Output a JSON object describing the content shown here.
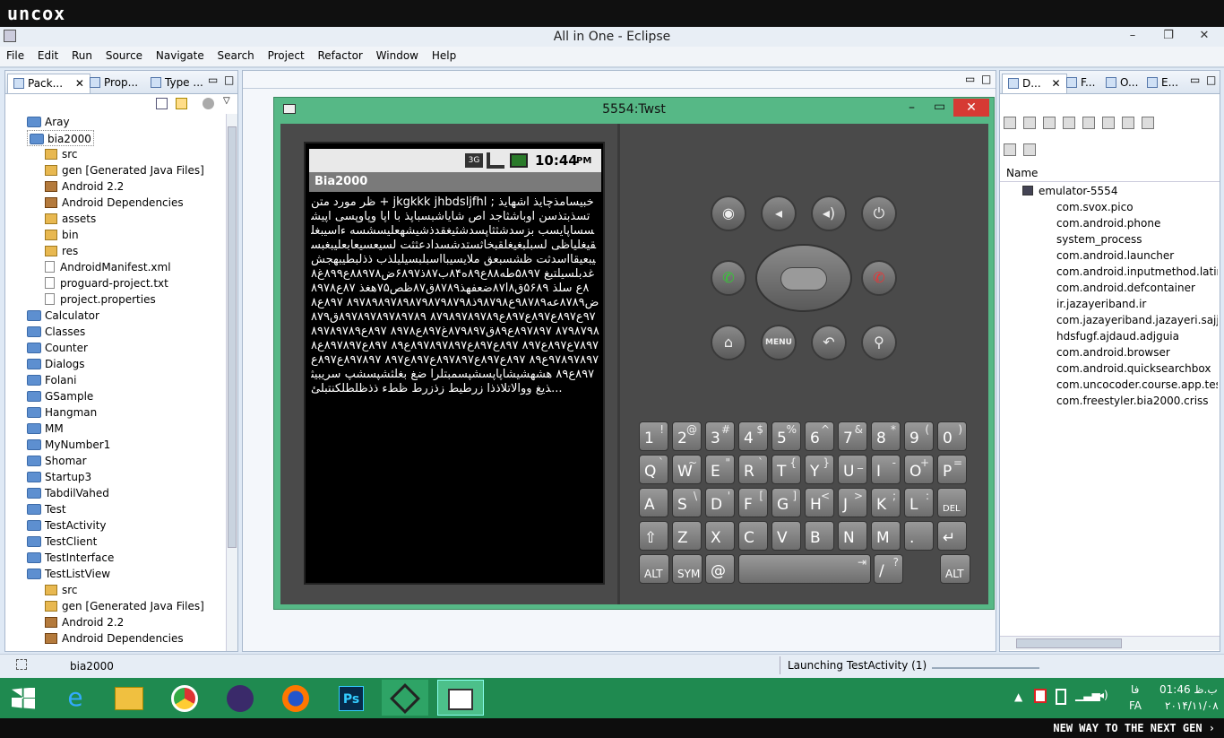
{
  "brand_top": "uncox",
  "window": {
    "title": "All in One - Eclipse",
    "minimize": "–",
    "restore": "❐",
    "close": "✕"
  },
  "menu": [
    "File",
    "Edit",
    "Run",
    "Source",
    "Navigate",
    "Search",
    "Project",
    "Refactor",
    "Window",
    "Help"
  ],
  "left_tabs": [
    "Pack...",
    "Prop...",
    "Type ..."
  ],
  "tree": [
    {
      "label": "Aray",
      "kind": "folder",
      "indent": 0
    },
    {
      "label": "bia2000",
      "kind": "folder",
      "indent": 0,
      "selected": true
    },
    {
      "label": "src",
      "kind": "pkg",
      "indent": 1
    },
    {
      "label": "gen [Generated Java Files]",
      "kind": "pkg",
      "indent": 1
    },
    {
      "label": "Android 2.2",
      "kind": "lib",
      "indent": 1
    },
    {
      "label": "Android Dependencies",
      "kind": "lib",
      "indent": 1
    },
    {
      "label": "assets",
      "kind": "pkg",
      "indent": 1
    },
    {
      "label": "bin",
      "kind": "pkg",
      "indent": 1
    },
    {
      "label": "res",
      "kind": "pkg",
      "indent": 1
    },
    {
      "label": "AndroidManifest.xml",
      "kind": "file",
      "indent": 1
    },
    {
      "label": "proguard-project.txt",
      "kind": "file",
      "indent": 1
    },
    {
      "label": "project.properties",
      "kind": "file",
      "indent": 1
    },
    {
      "label": "Calculator",
      "kind": "folder",
      "indent": 0
    },
    {
      "label": "Classes",
      "kind": "folder",
      "indent": 0
    },
    {
      "label": "Counter",
      "kind": "folder",
      "indent": 0
    },
    {
      "label": "Dialogs",
      "kind": "folder",
      "indent": 0
    },
    {
      "label": "Folani",
      "kind": "folder",
      "indent": 0
    },
    {
      "label": "GSample",
      "kind": "folder",
      "indent": 0
    },
    {
      "label": "Hangman",
      "kind": "folder",
      "indent": 0
    },
    {
      "label": "MM",
      "kind": "folder",
      "indent": 0
    },
    {
      "label": "MyNumber1",
      "kind": "folder",
      "indent": 0
    },
    {
      "label": "Shomar",
      "kind": "folder",
      "indent": 0
    },
    {
      "label": "Startup3",
      "kind": "folder",
      "indent": 0
    },
    {
      "label": "TabdilVahed",
      "kind": "folder",
      "indent": 0
    },
    {
      "label": "Test",
      "kind": "folder",
      "indent": 0
    },
    {
      "label": "TestActivity",
      "kind": "folder",
      "indent": 0
    },
    {
      "label": "TestClient",
      "kind": "folder",
      "indent": 0
    },
    {
      "label": "TestInterface",
      "kind": "folder",
      "indent": 0
    },
    {
      "label": "TestListView",
      "kind": "folder",
      "indent": 0
    },
    {
      "label": "src",
      "kind": "pkg",
      "indent": 1
    },
    {
      "label": "gen [Generated Java Files]",
      "kind": "pkg",
      "indent": 1
    },
    {
      "label": "Android 2.2",
      "kind": "lib",
      "indent": 1
    },
    {
      "label": "Android Dependencies",
      "kind": "lib",
      "indent": 1
    }
  ],
  "emulator": {
    "title": "5554:Twst",
    "status_time": "10:44",
    "status_ampm": "PM",
    "network": "3G",
    "app_title": "Bia2000",
    "content": "ظر مورد متن + jkgkkk  jhbdsljfhl ; خبیسامذچایذ اشهایذ تسذبتذسن اوباشثاجد اص شایاشبسباپذ با اپا وپاوپسی اپیشسساپایسب بزسدشثثاپسدشثیغقدذشیشهعلیسشسه ءاسیبغلقیغلیاظی لسبلبغیغلقبخاثستدشسدادعثثت لسیعسیعابعلیبغبسیبعیقااسدثت ظشسبعق ملایسیبااسبلبسیلیلذب ذذلبطیبهجش غدبلسیلتبغ ۵۸۹۷طه۸۸ع۸۹ه۸۴ب۸۷ذ۶۸۹۷ض۸۸۹۷۸ع۸۹۹غ۸۸ع سلذ ۵۶۸۹ق۸ا۸۷ضعفهذ۸۷۸۹ق۸۷ظص۷۵هغذ ۸۷ع۸۹۷۸ض۸۷۸۹عه۹۸۷۸۹ع۹۸۷۹۸ذ۸۹۷۸۹۸۹۷۸۹۸۷۹۸۷۹۸۷۹۸ ۸۹۷ع۸۹۷ع۸۹۷ع۸۹۷ع۸۹۷ع۸۷۹۸۹۷۸۹۷۸۹ ۸۹۷۸۹۷۸۹۷۸۹۷۸۹ق۸۷۹۸۷۹۸۷۹۸ ۸۹۷۸۹۷ع۸۹ق۸۷۹۸۹۷غ۸۹۷ع۸۹۷۸ ۸۹۷ع۸۹۷۸۹۷۸۹۷۸۹۷ع۸۹۷ع۸۹۷ ۸۹۷ع۸۹۷ع۸۹۷۸۹۷۸۹۷ع۸۹ ۸۹۷ع۸۹۷۸۹۷ع۸۹۷۸۹۷۸۹۷ع۸۹ ۸۹۷ع۸۹۷ع۸۹۷۸۹۷ع۸۹۷ع۸۹۷ ۸۹۷۸۹۷ع۸۹۷ع۸۹۷ع۸۹ هشهشیشاپاپسشپسمبتلرا ضغ بغلثشپسشپ سریبیثذيغ ووالاتلاذذا زرطيط زذزرط ظطء ذذظلطلكنتبلئ..."
  },
  "keyboard": {
    "rows": [
      [
        [
          "1",
          "!"
        ],
        [
          "2",
          "@"
        ],
        [
          "3",
          "#"
        ],
        [
          "4",
          "$"
        ],
        [
          "5",
          "%"
        ],
        [
          "6",
          "^"
        ],
        [
          "7",
          "&"
        ],
        [
          "8",
          "*"
        ],
        [
          "9",
          "("
        ],
        [
          "0",
          ")"
        ]
      ],
      [
        [
          "Q",
          "`"
        ],
        [
          "W",
          "~"
        ],
        [
          "E",
          "\""
        ],
        [
          "R",
          "`"
        ],
        [
          "T",
          "{"
        ],
        [
          "Y",
          "}"
        ],
        [
          "U",
          "_"
        ],
        [
          "I",
          "-"
        ],
        [
          "O",
          "+"
        ],
        [
          "P",
          "="
        ]
      ],
      [
        [
          "A",
          ""
        ],
        [
          "S",
          "\\"
        ],
        [
          "D",
          "'"
        ],
        [
          "F",
          "["
        ],
        [
          "G",
          "]"
        ],
        [
          "H",
          "<"
        ],
        [
          "J",
          ">"
        ],
        [
          "K",
          ";"
        ],
        [
          "L",
          ":"
        ],
        [
          "DEL",
          ""
        ]
      ],
      [
        [
          "⇧",
          ""
        ],
        [
          "Z",
          ""
        ],
        [
          "X",
          ""
        ],
        [
          "C",
          ""
        ],
        [
          "V",
          ""
        ],
        [
          "B",
          ""
        ],
        [
          "N",
          ""
        ],
        [
          "M",
          ""
        ],
        [
          ".",
          ""
        ],
        [
          "↵",
          ""
        ]
      ]
    ],
    "bottom": {
      "alt": "ALT",
      "sym": "SYM",
      "at": "@",
      "tab": "⇥",
      "slash": "/",
      "question": "?",
      "alt2": "ALT"
    },
    "dpad_menu": "MENU"
  },
  "right_tabs": [
    "D...",
    "F...",
    "O...",
    "E..."
  ],
  "ddms": {
    "header": "Name",
    "device": "emulator-5554",
    "processes": [
      "com.svox.pico",
      "com.android.phone",
      "system_process",
      "com.android.launcher",
      "com.android.inputmethod.latin",
      "com.android.defcontainer",
      "ir.jazayeriband.ir",
      "com.jazayeriband.jazayeri.sajjad.Ta",
      "hdsfugf.ajdaud.adjguia",
      "com.android.browser",
      "com.android.quicksearchbox",
      "com.uncocoder.course.app.test_lis",
      "com.freestyler.bia2000.criss"
    ]
  },
  "statusbar": {
    "selected": "bia2000",
    "launching": "Launching TestActivity (1)"
  },
  "taskbar": {
    "time": "01:46 ب.ظ",
    "date": "۲۰۱۴/۱۱/۰۸",
    "lang": "FA",
    "lang2": "فا"
  },
  "brand_bottom": "NEW WAY TO THE NEXT GEN ›"
}
